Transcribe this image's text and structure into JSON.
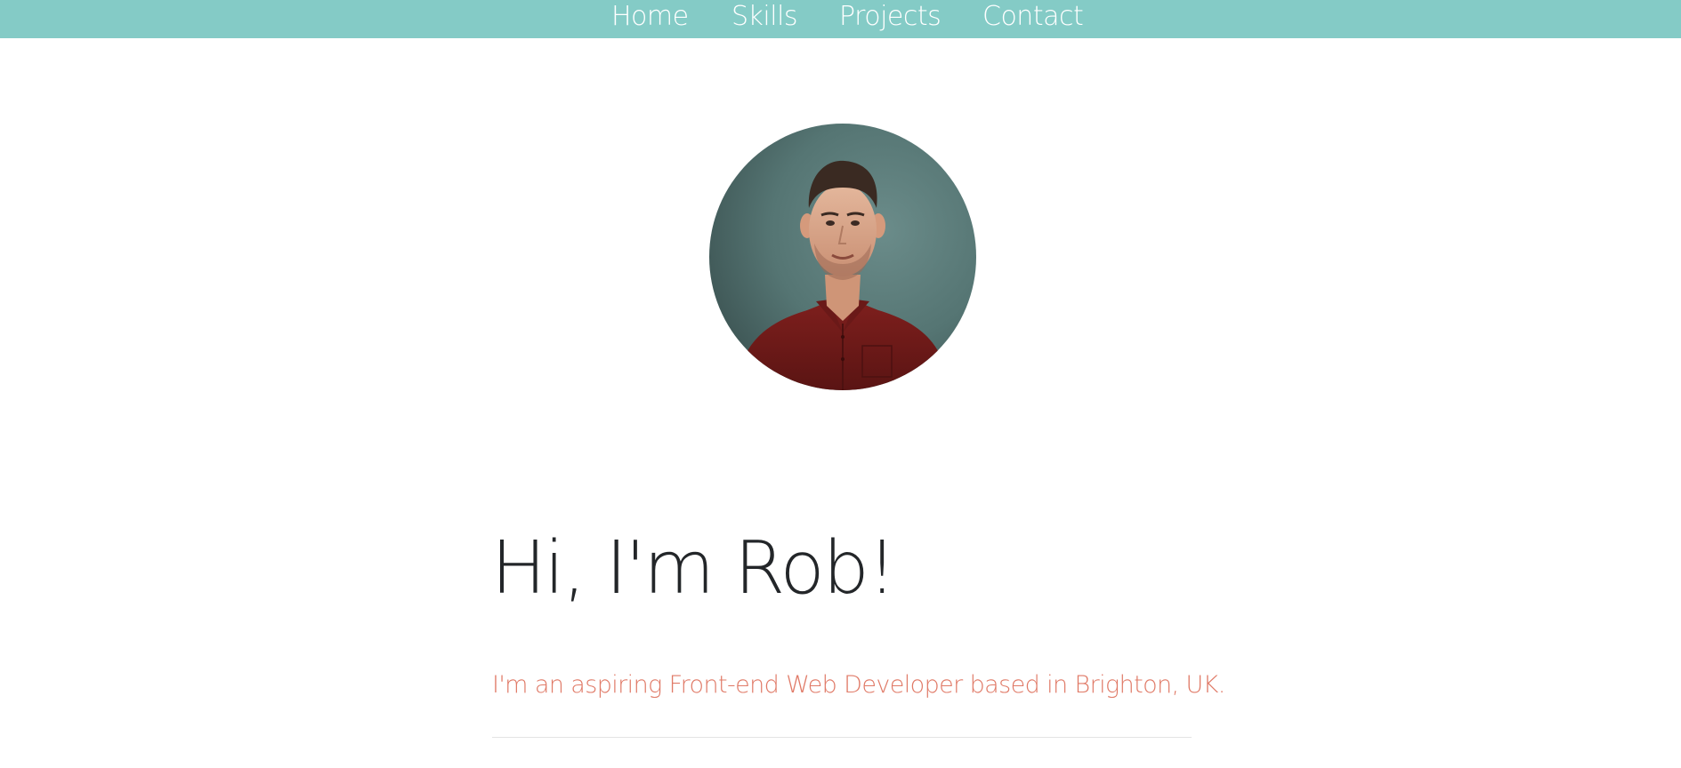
{
  "nav": {
    "home": "Home",
    "skills": "Skills",
    "projects": "Projects",
    "contact": "Contact"
  },
  "hero": {
    "title": "Hi, I'm Rob!",
    "subtitle": "I'm an aspiring Front-end Web Developer based in Brighton, UK."
  },
  "colors": {
    "nav_background": "#84cbc6",
    "nav_text": "#ffffff",
    "title_text": "#232629",
    "subtitle_text": "#e07a67"
  },
  "icons": {
    "avatar": "profile-photo"
  }
}
